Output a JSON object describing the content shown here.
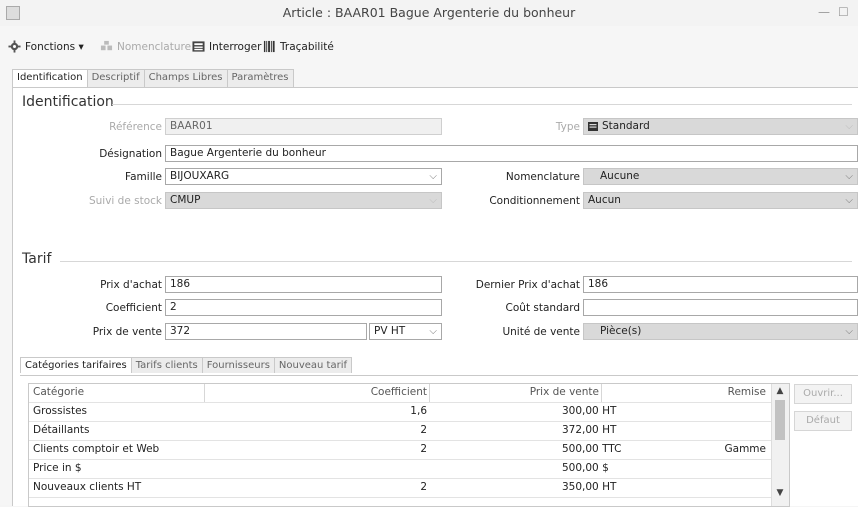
{
  "window": {
    "title": "Article : BAAR01 Bague Argenterie du bonheur"
  },
  "toolbar": {
    "fonctions": "Fonctions ▾",
    "nomenclature": "Nomenclature",
    "interroger": "Interroger",
    "tracabilite": "Traçabilité"
  },
  "tabs": [
    "Identification",
    "Descriptif",
    "Champs Libres",
    "Paramètres"
  ],
  "identification": {
    "section_title": "Identification",
    "reference_label": "Référence",
    "reference_value": "BAAR01",
    "type_label": "Type",
    "type_value": "Standard",
    "designation_label": "Désignation",
    "designation_value": "Bague Argenterie du bonheur",
    "famille_label": "Famille",
    "famille_value": "BIJOUXARG",
    "nomenclature_label": "Nomenclature",
    "nomenclature_value": "Aucune",
    "suivi_label": "Suivi de stock",
    "suivi_value": "CMUP",
    "conditionnement_label": "Conditionnement",
    "conditionnement_value": "Aucun"
  },
  "tarif": {
    "section_title": "Tarif",
    "prix_achat_label": "Prix d'achat",
    "prix_achat_value": "186",
    "dernier_prix_label": "Dernier Prix d'achat",
    "dernier_prix_value": "186",
    "coefficient_label": "Coefficient",
    "coefficient_value": "2",
    "cout_standard_label": "Coût standard",
    "cout_standard_value": "",
    "prix_vente_label": "Prix de vente",
    "prix_vente_value": "372",
    "prix_vente_unit": "PV HT",
    "unite_vente_label": "Unité de vente",
    "unite_vente_value": "Pièce(s)"
  },
  "subtabs": [
    "Catégories tarifaires",
    "Tarifs clients",
    "Fournisseurs",
    "Nouveau tarif"
  ],
  "grid": {
    "headers": [
      "Catégorie",
      "Coefficient",
      "Prix de vente",
      "Remise"
    ],
    "rows": [
      {
        "categorie": "Grossistes",
        "coefficient": "1,6",
        "prix": "300,00 HT",
        "remise": ""
      },
      {
        "categorie": "Détaillants",
        "coefficient": "2",
        "prix": "372,00 HT",
        "remise": ""
      },
      {
        "categorie": "Clients comptoir et  Web",
        "coefficient": "2",
        "prix": "500,00 TTC",
        "remise": "Gamme"
      },
      {
        "categorie": "Price in $",
        "coefficient": "",
        "prix": "500,00 $",
        "remise": ""
      },
      {
        "categorie": "Nouveaux clients HT",
        "coefficient": "2",
        "prix": "350,00 HT",
        "remise": ""
      }
    ]
  },
  "side_buttons": {
    "ouvrir": "Ouvrir...",
    "defaut": "Défaut"
  },
  "colors": {
    "window_bg": "#f6f6f6",
    "panel_bg": "#ffffff",
    "disabled_field": "#d9d9d9"
  },
  "icons": [
    "gear-icon",
    "nomenclature-icon",
    "interroger-icon",
    "barcode-icon",
    "type-standard-icon"
  ]
}
